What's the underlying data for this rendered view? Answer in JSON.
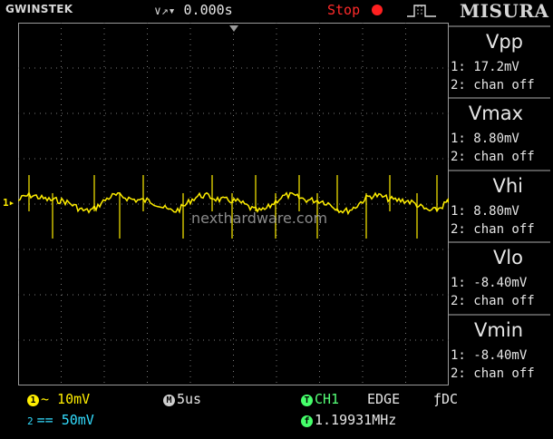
{
  "header": {
    "brand": "GWINSTEK",
    "trigger_arrow": "∨↗▾",
    "trigger_position": "0.000s",
    "run_state": "Stop",
    "panel_title": "MISURA"
  },
  "screen": {
    "channel_marker": "1▸",
    "watermark": "nexthardware.com"
  },
  "measurements": [
    {
      "name": "Vpp",
      "ch1": "1: 17.2mV",
      "ch2": "2: chan off"
    },
    {
      "name": "Vmax",
      "ch1": "1: 8.80mV",
      "ch2": "2: chan off"
    },
    {
      "name": "Vhi",
      "ch1": "1: 8.80mV",
      "ch2": "2: chan off"
    },
    {
      "name": "Vlo",
      "ch1": "1: -8.40mV",
      "ch2": "2: chan off"
    },
    {
      "name": "Vmin",
      "ch1": "1: -8.40mV",
      "ch2": "2: chan off"
    }
  ],
  "status": {
    "ch1_badge": "1",
    "ch1_scale": "~ 10mV",
    "ch2_badge": "2",
    "ch2_scale": "== 50mV",
    "timebase_badge": "M",
    "timebase": "5us",
    "trigger_badge": "T",
    "trigger_source": "CH1",
    "trigger_type": "EDGE",
    "trigger_coupling": "ƒDC",
    "freq_badge": "f",
    "frequency": "1.19931MHz"
  },
  "colors": {
    "ch1": "#ffee00",
    "ch2": "#33ddff",
    "stop": "#ff2020",
    "trigger": "#45ff6a"
  }
}
